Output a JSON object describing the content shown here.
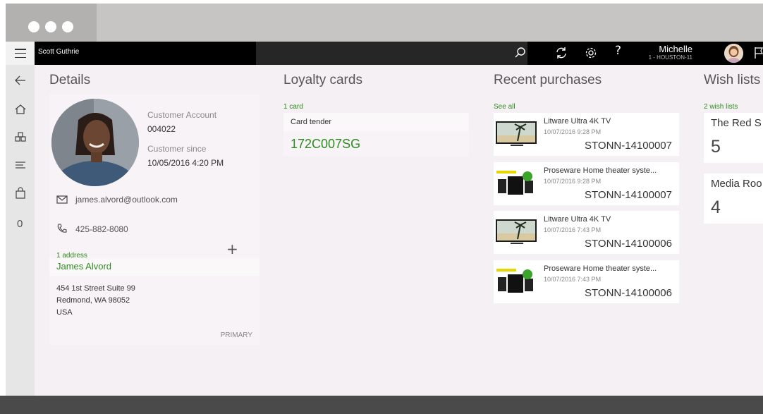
{
  "app": {
    "customer_name": "Scott Guthrie",
    "worker": {
      "name": "Michelle",
      "store": "1 - HOUSTON-11"
    },
    "help_label": "?"
  },
  "nav": {
    "badge_count": "0"
  },
  "details": {
    "title": "Details",
    "account_label": "Customer Account",
    "account_value": "004022",
    "since_label": "Customer since",
    "since_value": "10/05/2016 4:20 PM",
    "email": "james.alvord@outlook.com",
    "phone": "425-882-8080",
    "address_count": "1 address",
    "add_label": "+",
    "address": {
      "name": "James Alvord",
      "line1": "454 1st Street Suite 99",
      "line2": "Redmond, WA 98052",
      "line3": "USA",
      "tag": "PRIMARY"
    }
  },
  "loyalty": {
    "title": "Loyalty cards",
    "count": "1 card",
    "card_label": "Card tender",
    "card_number": "172C007SG"
  },
  "purchases": {
    "title": "Recent purchases",
    "see_all": "See all",
    "items": [
      {
        "name": "Litware Ultra 4K TV",
        "date": "10/07/2016 9:28 PM",
        "id": "STONN-14100007",
        "thumb": "tv-thumbnail"
      },
      {
        "name": "Proseware Home theater syste...",
        "date": "10/07/2016 9:28 PM",
        "id": "STONN-14100007",
        "thumb": "speaker-thumbnail"
      },
      {
        "name": "Litware Ultra 4K TV",
        "date": "10/07/2016 7:43 PM",
        "id": "STONN-14100006",
        "thumb": "tv-thumbnail"
      },
      {
        "name": "Proseware Home theater syste...",
        "date": "10/07/2016 7:43 PM",
        "id": "STONN-14100006",
        "thumb": "speaker-thumbnail"
      }
    ]
  },
  "wishlists": {
    "title": "Wish lists",
    "count": "2 wish lists",
    "items": [
      {
        "name": "The Red S",
        "count": "5"
      },
      {
        "name": "Media Roo",
        "count": "4"
      }
    ]
  },
  "colors": {
    "accent_green": "#2e8b1f",
    "appbar": "#000000",
    "nav": "#e6e6e6"
  },
  "icons": [
    "hamburger-icon",
    "search-icon",
    "refresh-icon",
    "gear-icon",
    "help-icon",
    "flag-icon",
    "back-arrow-icon",
    "home-icon",
    "products-icon",
    "list-icon",
    "shopping-bag-icon",
    "mail-icon",
    "phone-icon"
  ]
}
